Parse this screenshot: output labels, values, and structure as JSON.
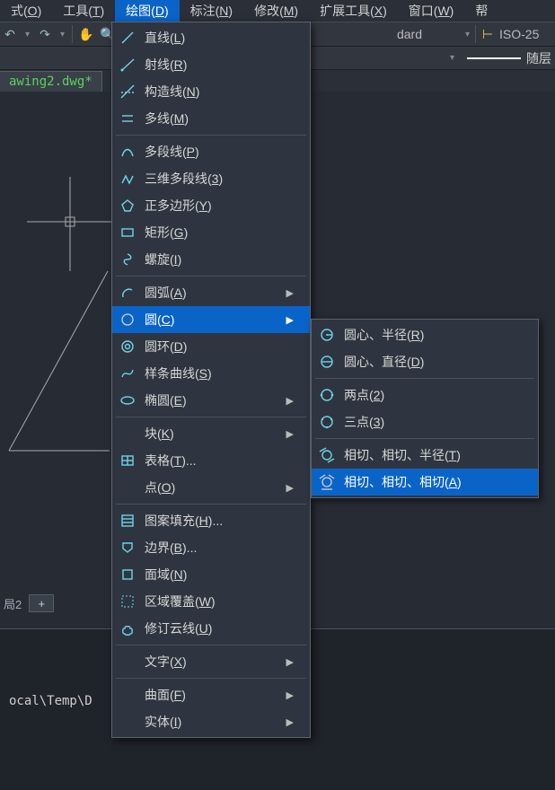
{
  "menubar": [
    {
      "label": "式(O)",
      "ul": "O",
      "active": false
    },
    {
      "label": "工具(T)",
      "ul": "T",
      "active": false
    },
    {
      "label": "绘图(D)",
      "ul": "D",
      "active": true
    },
    {
      "label": "标注(N)",
      "ul": "N",
      "active": false
    },
    {
      "label": "修改(M)",
      "ul": "M",
      "active": false
    },
    {
      "label": "扩展工具(X)",
      "ul": "X",
      "active": false
    },
    {
      "label": "窗口(W)",
      "ul": "W",
      "active": false
    },
    {
      "label": "帮",
      "ul": "",
      "active": false
    }
  ],
  "toolbar": {
    "standard": "dard",
    "iso": "ISO-25",
    "layer": "随层"
  },
  "filetab": "awing2.dwg*",
  "lower_tab": "局2",
  "command_text": "ocal\\Temp\\D",
  "draw_menu": [
    {
      "label": "直线(L)",
      "ul": "L",
      "sub": false,
      "icon": "line"
    },
    {
      "label": "射线(R)",
      "ul": "R",
      "sub": false,
      "icon": "ray"
    },
    {
      "label": "构造线(N)",
      "ul": "N",
      "sub": false,
      "icon": "xline"
    },
    {
      "label": "多线(M)",
      "ul": "M",
      "sub": false,
      "icon": "mline"
    },
    {
      "sep": true
    },
    {
      "label": "多段线(P)",
      "ul": "P",
      "sub": false,
      "icon": "pline"
    },
    {
      "label": "三维多段线(3)",
      "ul": "3",
      "sub": false,
      "icon": "3dpoly"
    },
    {
      "label": "正多边形(Y)",
      "ul": "Y",
      "sub": false,
      "icon": "polygon"
    },
    {
      "label": "矩形(G)",
      "ul": "G",
      "sub": false,
      "icon": "rect"
    },
    {
      "label": "螺旋(I)",
      "ul": "I",
      "sub": false,
      "icon": "helix"
    },
    {
      "sep": true
    },
    {
      "label": "圆弧(A)",
      "ul": "A",
      "sub": true,
      "icon": "arc"
    },
    {
      "label": "圆(C)",
      "ul": "C",
      "sub": true,
      "icon": "circle",
      "hl": true
    },
    {
      "label": "圆环(D)",
      "ul": "D",
      "sub": false,
      "icon": "donut"
    },
    {
      "label": "样条曲线(S)",
      "ul": "S",
      "sub": false,
      "icon": "spline"
    },
    {
      "label": "椭圆(E)",
      "ul": "E",
      "sub": true,
      "icon": "ellipse"
    },
    {
      "sep": true
    },
    {
      "label": "块(K)",
      "ul": "K",
      "sub": true,
      "icon": ""
    },
    {
      "label": "表格(T)...",
      "ul": "T",
      "sub": false,
      "icon": "table"
    },
    {
      "label": "点(O)",
      "ul": "O",
      "sub": true,
      "icon": ""
    },
    {
      "sep": true
    },
    {
      "label": "图案填充(H)...",
      "ul": "H",
      "sub": false,
      "icon": "hatch"
    },
    {
      "label": "边界(B)...",
      "ul": "B",
      "sub": false,
      "icon": "boundary"
    },
    {
      "label": "面域(N)",
      "ul": "N",
      "sub": false,
      "icon": "region"
    },
    {
      "label": "区域覆盖(W)",
      "ul": "W",
      "sub": false,
      "icon": "wipeout"
    },
    {
      "label": "修订云线(U)",
      "ul": "U",
      "sub": false,
      "icon": "revcloud"
    },
    {
      "sep": true
    },
    {
      "label": "文字(X)",
      "ul": "X",
      "sub": true,
      "icon": ""
    },
    {
      "sep": true
    },
    {
      "label": "曲面(F)",
      "ul": "F",
      "sub": true,
      "icon": ""
    },
    {
      "label": "实体(I)",
      "ul": "I",
      "sub": true,
      "icon": ""
    }
  ],
  "circle_menu": [
    {
      "label": "圆心、半径(R)",
      "ul": "R",
      "icon": "c1"
    },
    {
      "label": "圆心、直径(D)",
      "ul": "D",
      "icon": "c2"
    },
    {
      "sep": true
    },
    {
      "label": "两点(2)",
      "ul": "2",
      "icon": "c3"
    },
    {
      "label": "三点(3)",
      "ul": "3",
      "icon": "c4"
    },
    {
      "sep": true
    },
    {
      "label": "相切、相切、半径(T)",
      "ul": "T",
      "icon": "c5"
    },
    {
      "label": "相切、相切、相切(A)",
      "ul": "A",
      "icon": "c6",
      "hl": true
    }
  ]
}
